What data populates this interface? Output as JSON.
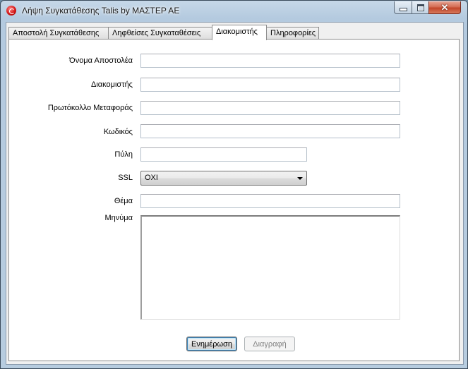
{
  "window": {
    "title": "Λήψη Συγκατάθεσης Talis by ΜΑΣΤΕΡ ΑΕ",
    "icon": "app-logo-icon",
    "controls": {
      "minimize_icon": "minimize-icon",
      "maximize_icon": "maximize-icon",
      "close_icon": "close-icon",
      "close_glyph": "✕"
    }
  },
  "tabs": [
    {
      "label": "Αποστολή Συγκατάθεσης",
      "active": false
    },
    {
      "label": "Ληφθείσες Συγκαταθέσεις",
      "active": false
    },
    {
      "label": "Διακομιστής",
      "active": true
    },
    {
      "label": "Πληροφορίες",
      "active": false
    }
  ],
  "form": {
    "sender_name": {
      "label": "Όνομα Αποστολέα",
      "value": ""
    },
    "server": {
      "label": "Διακομιστής",
      "value": ""
    },
    "protocol": {
      "label": "Πρωτόκολλο Μεταφοράς",
      "value": ""
    },
    "password": {
      "label": "Κωδικός",
      "value": ""
    },
    "port": {
      "label": "Πύλη",
      "value": ""
    },
    "ssl": {
      "label": "SSL",
      "selected": "ΟΧΙ"
    },
    "subject": {
      "label": "Θέμα",
      "value": ""
    },
    "message": {
      "label": "Μηνύμα",
      "value": ""
    }
  },
  "buttons": {
    "update": "Ενημέρωση",
    "delete": "Διαγραφή",
    "delete_enabled": false
  },
  "colors": {
    "titlebar": "#b4cadf",
    "close_button": "#c2452a",
    "panel_background": "#ffffff",
    "focus_border": "#3c7fb1"
  }
}
